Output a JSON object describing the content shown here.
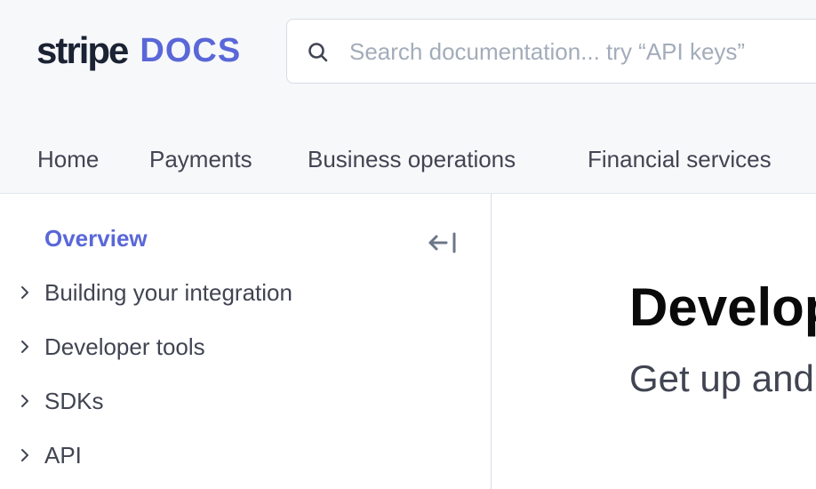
{
  "logo": {
    "wordmark": "stripe",
    "product": "DOCS"
  },
  "search": {
    "placeholder": "Search documentation... try “API keys”",
    "value": "",
    "icon": "search-icon"
  },
  "topnav": {
    "items": [
      "Home",
      "Payments",
      "Business operations",
      "Financial services"
    ]
  },
  "sidebar": {
    "overview": "Overview",
    "collapse_icon": "collapse-sidebar-icon",
    "items": [
      {
        "label": "Building your integration"
      },
      {
        "label": "Developer tools"
      },
      {
        "label": "SDKs"
      },
      {
        "label": "API"
      }
    ]
  },
  "main": {
    "title": "Develop",
    "subtitle": "Get up and"
  },
  "colors": {
    "accent": "#5a67d8",
    "text": "#414552",
    "header_bg": "#f7f8fa",
    "logo_dark": "#1a2233"
  }
}
